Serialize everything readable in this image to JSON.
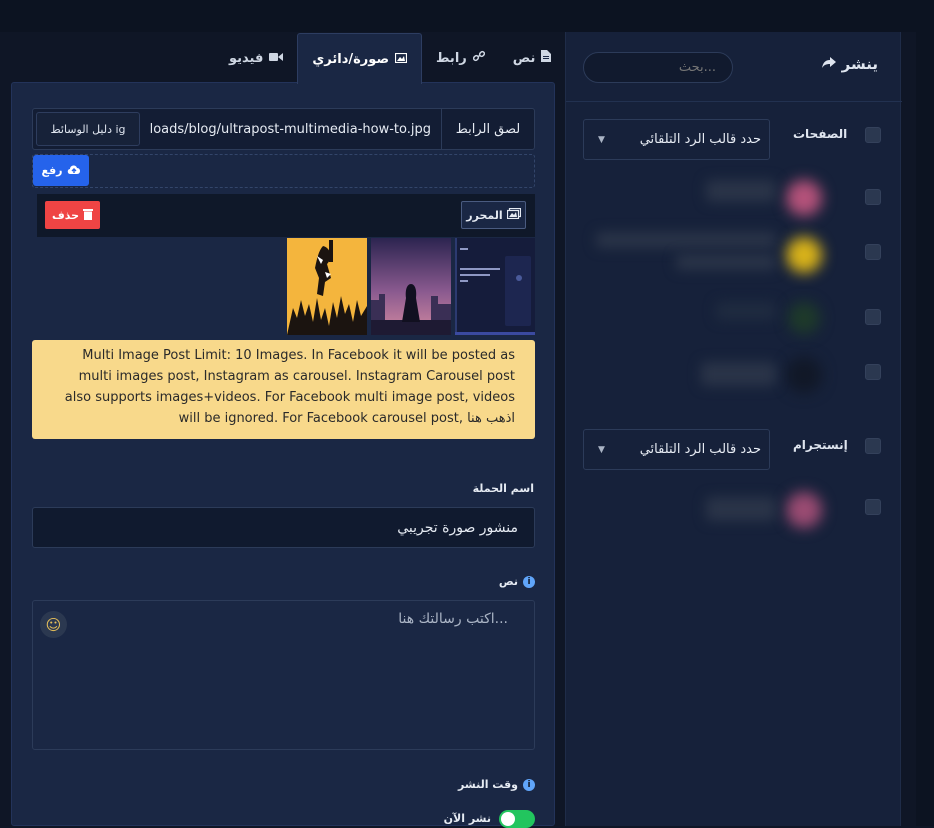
{
  "publish": {
    "title": "ينشر",
    "search_placeholder": "بحث..."
  },
  "sections": {
    "pages": {
      "label": "الصفحات",
      "select": "حدد قالب الرد التلقائي"
    },
    "instagram": {
      "label": "إنستجرام",
      "select": "حدد قالب الرد التلقائي"
    }
  },
  "tabs": [
    {
      "label": "نص",
      "icon": "file-icon"
    },
    {
      "label": "رابط",
      "icon": "link-icon"
    },
    {
      "label": "صورة/دائري",
      "icon": "image-icon",
      "active": true
    },
    {
      "label": "فيديو",
      "icon": "video-icon"
    }
  ],
  "media": {
    "paste_label": "لصق الرابط",
    "url": "loads/blog/ultrapost-multimedia-how-to.jpg",
    "library_button": "دليل الوسائط ig",
    "upload_button": "رفع",
    "editor_button": "المحرر",
    "delete_button": "حذف"
  },
  "notice": "Multi Image Post Limit: 10 Images. In Facebook it will be posted as multi images post, Instagram as carousel. Instagram Carousel post also supports images+videos. For Facebook multi image post, videos will be ignored. For Facebook carousel post, اذهب هنا",
  "campaign": {
    "label": "اسم الحملة",
    "value": "منشور صورة تجريبي"
  },
  "message": {
    "label": "نص",
    "placeholder": "اكتب رسالتك هنا..."
  },
  "schedule": {
    "label": "وقت النشر",
    "toggle_label": "نشر الآن",
    "toggle_on": true
  },
  "colors": {
    "accent": "#2563eb",
    "danger": "#ef4444",
    "success": "#22c55e",
    "notice_bg": "#f8d98b"
  }
}
